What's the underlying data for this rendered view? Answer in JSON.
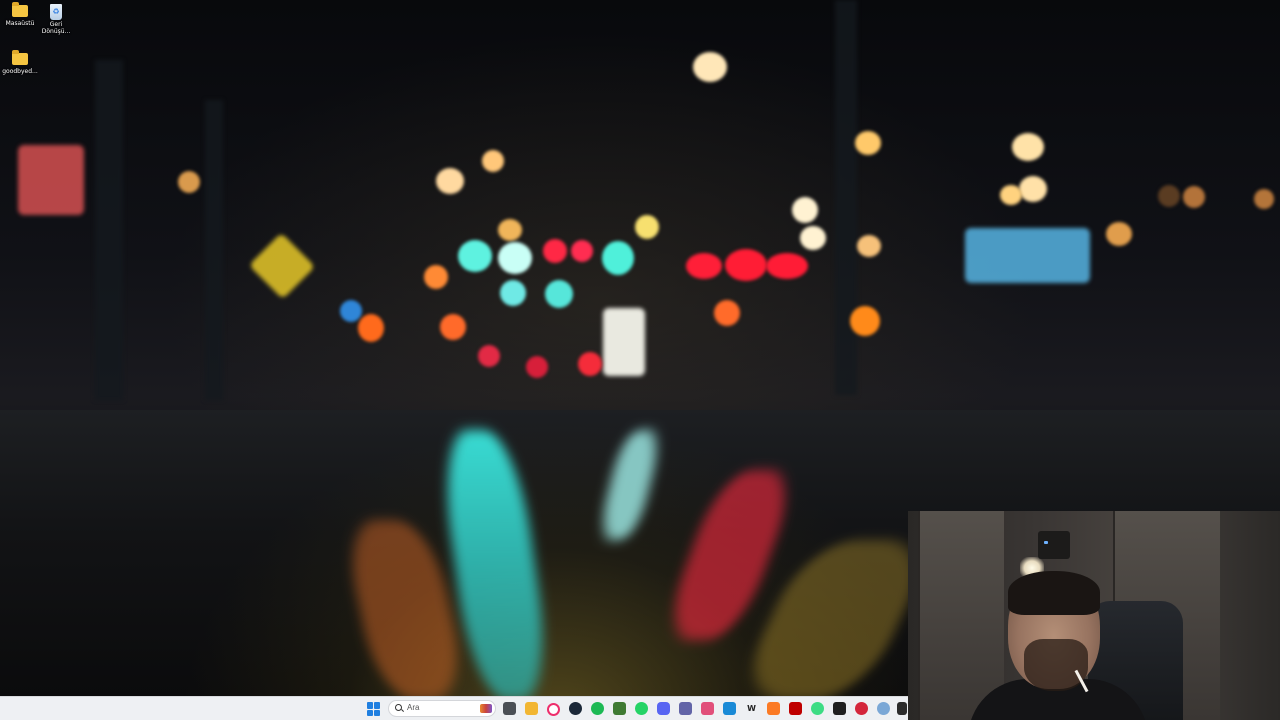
{
  "desktop": {
    "icons": [
      {
        "label": "Masaüstü",
        "icon": "folder-icon"
      },
      {
        "label": "Geri Dönüşü...",
        "icon": "recycle-bin-icon"
      },
      {
        "label": "goodbyed...",
        "icon": "folder-icon"
      }
    ]
  },
  "taskbar": {
    "search_placeholder": "Ara",
    "start_icon": "windows-start-icon",
    "pinned_apps": [
      "file-explorer-icon",
      "store-icon",
      "opera-gx-icon",
      "steam-icon",
      "spotify-icon",
      "minecraft-launcher-icon",
      "whatsapp-icon",
      "discord-icon",
      "teams-icon",
      "capcut-icon",
      "vscode-icon",
      "word-icon",
      "xampp-icon",
      "filezilla-icon",
      "android-icon",
      "epic-games-icon",
      "obs-icon",
      "settings-icon",
      "terminal-icon"
    ],
    "colors": {
      "background": "#eef0f3",
      "start_accent": "#1f7fe0"
    }
  },
  "webcam": {
    "description_icon": "webcam-overlay"
  }
}
